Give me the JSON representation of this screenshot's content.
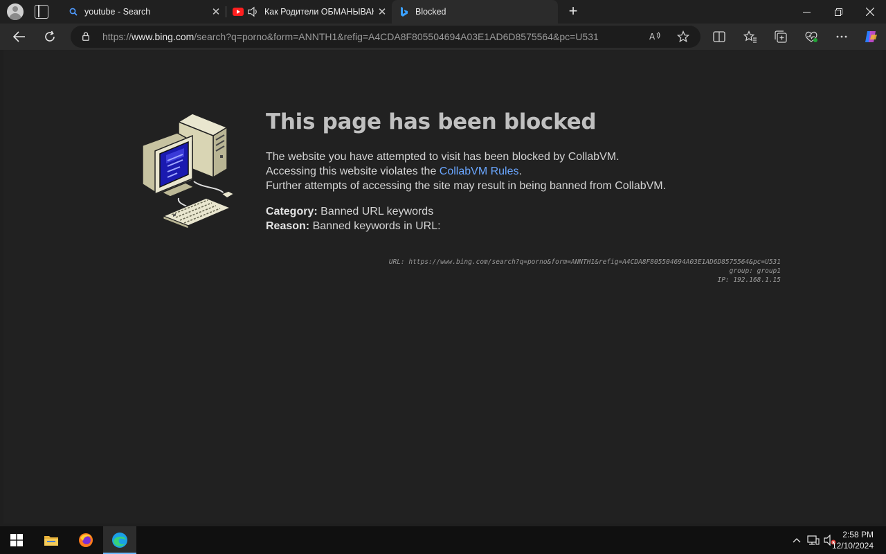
{
  "browser": {
    "tabs": [
      {
        "title": "youtube - Search",
        "icon": "search-icon"
      },
      {
        "title": "Как Родители ОБМАНЫВАЮ",
        "icon": "youtube-icon"
      },
      {
        "title": "Blocked",
        "icon": "bing-icon"
      }
    ],
    "address": {
      "prefix": "https://",
      "domain": "www.bing.com",
      "path": "/search?q=porno&form=ANNTH1&refig=A4CDA8F805504694A03E1AD6D8575564&pc=U531"
    }
  },
  "blocked_page": {
    "heading": "This page has been blocked",
    "line1": "The website you have attempted to visit has been blocked by CollabVM.",
    "line2_prefix": "Accessing this website violates the ",
    "line2_link": "CollabVM Rules",
    "line2_suffix": ".",
    "line3": "Further attempts of accessing the site may result in being banned from CollabVM.",
    "category_label": "Category:",
    "category_value": "Banned URL keywords",
    "reason_label": "Reason:",
    "reason_value": "Banned keywords in URL:",
    "meta_url": "URL: https://www.bing.com/search?q=porno&form=ANNTH1&refig=A4CDA8F805504694A03E1AD6D8575564&pc=U531",
    "meta_group": "group: group1",
    "meta_ip": "IP: 192.168.1.15"
  },
  "taskbar": {
    "time": "2:58 PM",
    "date": "12/10/2024"
  },
  "colors": {
    "link": "#6aa6ff",
    "page_bg": "#212121",
    "edge_accent": "#6cb8ff"
  }
}
